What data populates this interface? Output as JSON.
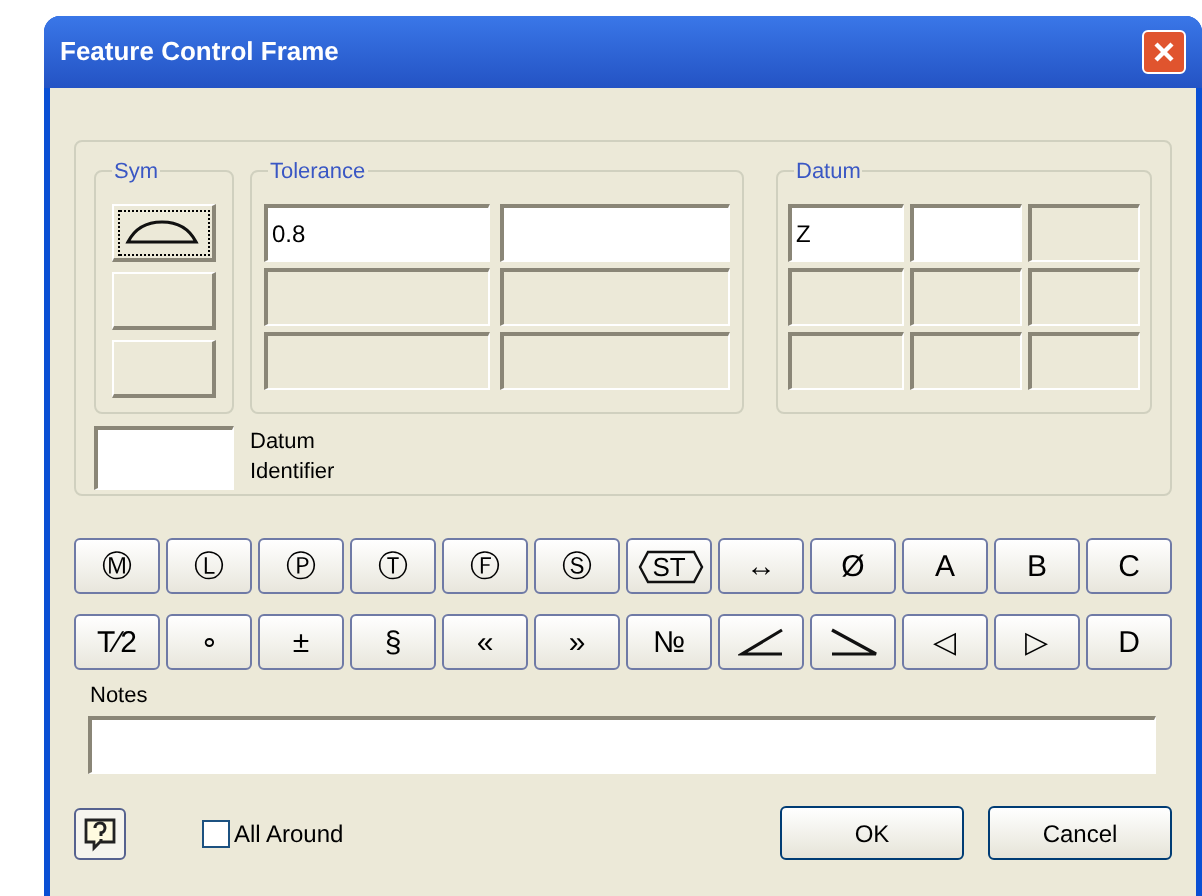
{
  "window": {
    "title": "Feature Control Frame"
  },
  "sym": {
    "label": "Sym",
    "buttons": [
      {
        "kind": "profile",
        "focused": true
      },
      {
        "kind": "empty",
        "focused": false
      },
      {
        "kind": "empty",
        "focused": false
      }
    ]
  },
  "tolerance": {
    "label": "Tolerance",
    "rows": [
      [
        {
          "value": "0.8",
          "enabled": true
        },
        {
          "enabled": true
        }
      ],
      [
        {
          "enabled": false
        },
        {
          "enabled": false
        }
      ],
      [
        {
          "enabled": false
        },
        {
          "enabled": false
        }
      ]
    ]
  },
  "datum": {
    "label": "Datum",
    "rows": [
      [
        {
          "value": "Z",
          "enabled": true
        },
        {
          "enabled": true
        },
        {
          "enabled": false
        }
      ],
      [
        {
          "enabled": false
        },
        {
          "enabled": false
        },
        {
          "enabled": false
        }
      ],
      [
        {
          "enabled": false
        },
        {
          "enabled": false
        },
        {
          "enabled": false
        }
      ]
    ]
  },
  "datum_identifier": {
    "label": "Datum Identifier"
  },
  "symbol_rows": [
    [
      {
        "kind": "text",
        "label": "Ⓜ"
      },
      {
        "kind": "text",
        "label": "Ⓛ"
      },
      {
        "kind": "text",
        "label": "Ⓟ"
      },
      {
        "kind": "text",
        "label": "Ⓣ"
      },
      {
        "kind": "text",
        "label": "Ⓕ"
      },
      {
        "kind": "text",
        "label": "Ⓢ"
      },
      {
        "kind": "hexagon",
        "label": "ST"
      },
      {
        "kind": "text",
        "label": "↔"
      },
      {
        "kind": "text",
        "label": "Ø"
      },
      {
        "kind": "text",
        "label": "A"
      },
      {
        "kind": "text",
        "label": "B"
      },
      {
        "kind": "text",
        "label": "C"
      }
    ],
    [
      {
        "kind": "text",
        "label": "T⁄2"
      },
      {
        "kind": "text",
        "label": "∘"
      },
      {
        "kind": "text",
        "label": "±"
      },
      {
        "kind": "text",
        "label": "§"
      },
      {
        "kind": "text",
        "label": "«"
      },
      {
        "kind": "text",
        "label": "»"
      },
      {
        "kind": "text",
        "label": "№"
      },
      {
        "kind": "angle"
      },
      {
        "kind": "slope"
      },
      {
        "kind": "text",
        "label": "◁"
      },
      {
        "kind": "text",
        "label": "▷"
      },
      {
        "kind": "text",
        "label": "D"
      }
    ]
  ],
  "notes": {
    "label": "Notes"
  },
  "all_around": {
    "label": "All Around",
    "checked": false
  },
  "buttons": [
    "OK",
    "Cancel"
  ]
}
